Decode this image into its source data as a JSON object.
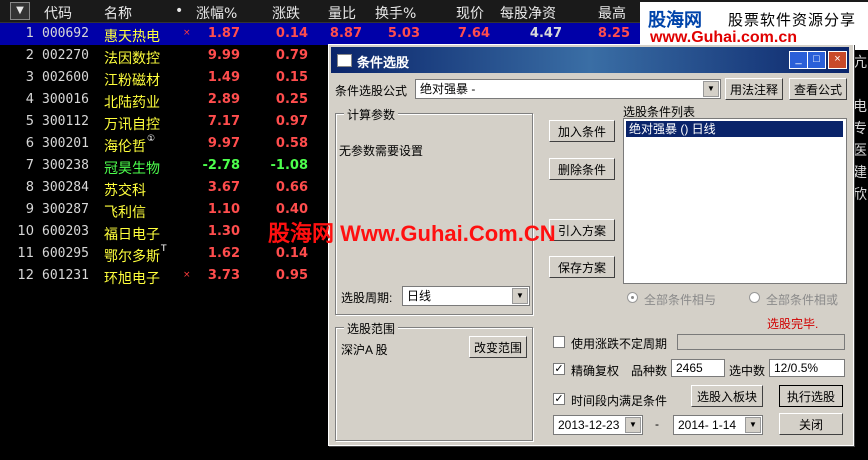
{
  "table": {
    "dropdown_glyph": "▼",
    "headers": [
      "代码",
      "名称",
      "•",
      "涨幅%",
      "涨跌",
      "量比",
      "换手%",
      "现价",
      "每股净资",
      "最高"
    ],
    "rows": [
      {
        "idx": "1",
        "code": "000692",
        "name": "惠天热电",
        "mark": "×",
        "pct": "1.87",
        "chg": "0.14",
        "vol": "8.87",
        "turn": "5.03",
        "price": "7.64",
        "nav": "4.47",
        "high": "8.25",
        "dir": "up"
      },
      {
        "idx": "2",
        "code": "002270",
        "name": "法因数控",
        "mark": "",
        "pct": "9.99",
        "chg": "0.79",
        "dir": "up"
      },
      {
        "idx": "3",
        "code": "002600",
        "name": "江粉磁材",
        "mark": "",
        "pct": "1.49",
        "chg": "0.15",
        "dir": "up"
      },
      {
        "idx": "4",
        "code": "300016",
        "name": "北陆药业",
        "mark": "",
        "pct": "2.89",
        "chg": "0.25",
        "dir": "up"
      },
      {
        "idx": "5",
        "code": "300112",
        "name": "万讯自控",
        "mark": "",
        "pct": "7.17",
        "chg": "0.97",
        "dir": "up"
      },
      {
        "idx": "6",
        "code": "300201",
        "name": "海伦哲",
        "sup": "①",
        "mark": "",
        "pct": "9.97",
        "chg": "0.58",
        "dir": "up"
      },
      {
        "idx": "7",
        "code": "300238",
        "name": "冠昊生物",
        "mark": "",
        "pct": "-2.78",
        "chg": "-1.08",
        "dir": "down"
      },
      {
        "idx": "8",
        "code": "300284",
        "name": "苏交科",
        "mark": "",
        "pct": "3.67",
        "chg": "0.66",
        "dir": "up"
      },
      {
        "idx": "9",
        "code": "300287",
        "name": "飞利信",
        "mark": "",
        "pct": "1.10",
        "chg": "0.40",
        "dir": "up"
      },
      {
        "idx": "10",
        "code": "600203",
        "name": "福日电子",
        "mark": "",
        "pct": "1.30",
        "chg": "",
        "dir": "up"
      },
      {
        "idx": "11",
        "code": "600295",
        "name": "鄂尔多斯",
        "sup": "T",
        "mark": "",
        "pct": "1.62",
        "chg": "0.14",
        "dir": "up"
      },
      {
        "idx": "12",
        "code": "601231",
        "name": "环旭电子",
        "mark": "×",
        "pct": "3.73",
        "chg": "0.95",
        "dir": "up"
      }
    ],
    "right_edge_chars": [
      "亢",
      "电",
      "专",
      "医",
      "建",
      "欣"
    ]
  },
  "watermark": {
    "logo": "股海网",
    "tagline": "股票软件资源分享",
    "url": "www.Guhai.com.cn",
    "center_text": "股海网 Www.Guhai.Com.CN"
  },
  "dialog": {
    "title": "条件选股",
    "title_buttons": [
      "_",
      "□",
      "×"
    ],
    "formula_label": "条件选股公式",
    "formula_value": "绝对强暴 -",
    "usage_btn": "用法注释",
    "view_formula_btn": "查看公式",
    "calc_group": "计算参数",
    "no_params": "无参数需要设置",
    "period_label": "选股周期:",
    "period_value": "日线",
    "add_btn": "加入条件",
    "delete_btn": "删除条件",
    "import_btn": "引入方案",
    "save_btn": "保存方案",
    "list_label": "选股条件列表",
    "list_items": [
      "绝对强暴 () 日线"
    ],
    "radio_all_and": "全部条件相与",
    "radio_all_or": "全部条件相或",
    "status": "选股完毕.",
    "scope_group": "选股范围",
    "scope_value": "深沪A 股",
    "change_scope_btn": "改变范围",
    "use_limit_label": "使用涨跌不定周期",
    "exact_label": "精确复权",
    "count_label": "品种数",
    "count_value": "2465",
    "selected_label": "选中数",
    "selected_value": "12/0.5%",
    "to_sector_btn": "选股入板块",
    "execute_btn": "执行选股",
    "in_period_label": "时间段内满足条件",
    "date_from": "2013-12-23",
    "date_sep": "-",
    "date_to": "2014- 1-14",
    "close_btn": "关闭"
  },
  "colors": {
    "up": "#ff4d4d",
    "down": "#4dff4d",
    "name": "#ffff3c",
    "selected_row": "#0000a8",
    "dialog_bg": "#d4d0c8"
  }
}
